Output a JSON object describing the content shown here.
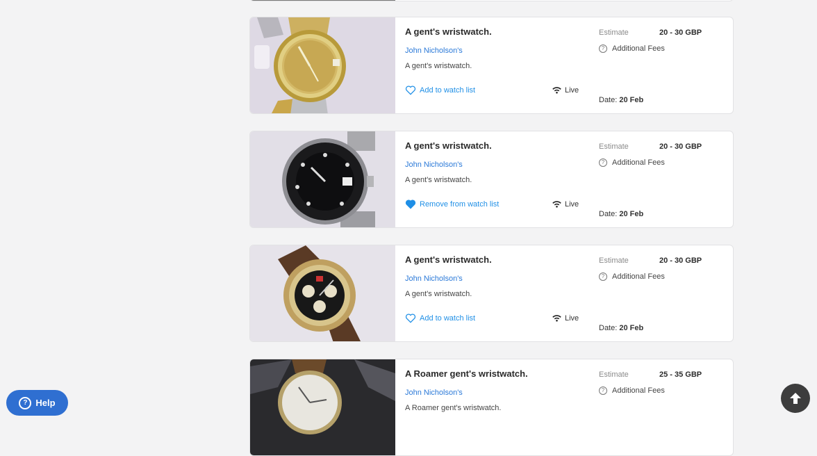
{
  "lots": [
    {
      "title": "A gent's wristwatch.",
      "auctioneer": "John Nicholson's",
      "description": "A gent's wristwatch.",
      "watch_label": "Add to watch list",
      "watched": false,
      "live_label": "Live",
      "estimate_label": "Estimate",
      "estimate_value": "20 - 30 GBP",
      "fees_label": "Additional Fees",
      "date_label": "Date:",
      "date_value": "20 Feb",
      "image": "gold-datejust-watch"
    },
    {
      "title": "A gent's wristwatch.",
      "auctioneer": "John Nicholson's",
      "description": "A gent's wristwatch.",
      "watch_label": "Remove from watch list",
      "watched": true,
      "live_label": "Live",
      "estimate_label": "Estimate",
      "estimate_value": "20 - 30 GBP",
      "fees_label": "Additional Fees",
      "date_label": "Date:",
      "date_value": "20 Feb",
      "image": "black-gmt-watch"
    },
    {
      "title": "A gent's wristwatch.",
      "auctioneer": "John Nicholson's",
      "description": "A gent's wristwatch.",
      "watch_label": "Add to watch list",
      "watched": false,
      "live_label": "Live",
      "estimate_label": "Estimate",
      "estimate_value": "20 - 30 GBP",
      "fees_label": "Additional Fees",
      "date_label": "Date:",
      "date_value": "20 Feb",
      "image": "chronograph-watch"
    },
    {
      "title": "A Roamer gent's wristwatch.",
      "auctioneer": "John Nicholson's",
      "description": "A Roamer gent's wristwatch.",
      "estimate_label": "Estimate",
      "estimate_value": "25 - 35 GBP",
      "fees_label": "Additional Fees",
      "image": "roamer-watch"
    }
  ],
  "help": {
    "label": "Help",
    "icon": "question-circle-icon"
  },
  "scroll_top": {
    "icon": "arrow-up-icon"
  },
  "colors": {
    "link": "#2a79d8",
    "watch": "#1f8fe6",
    "help_bg": "#2f6fd1"
  }
}
